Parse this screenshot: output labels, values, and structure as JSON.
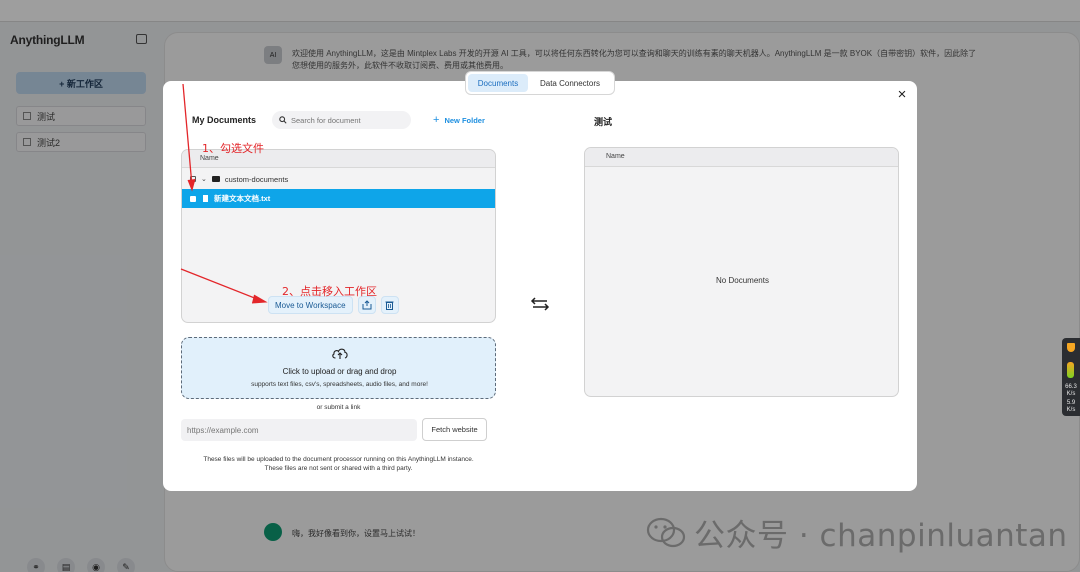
{
  "app": {
    "logo": "AnythingLLM",
    "new_workspace_label": "+ 新工作区",
    "workspaces": [
      "测试",
      "测试2"
    ],
    "footer_icons": [
      "link-icon",
      "book-icon",
      "discord-icon",
      "wrench-icon"
    ]
  },
  "chat": {
    "bot_avatar_label": "AI",
    "intro_line1": "欢迎使用 AnythingLLM，这是由 Mintplex Labs 开发的开源 AI 工具，可以将任何东西转化为您可以查询和聊天的训练有素的聊天机器人。AnythingLLM 是一款 BYOK（自带密钥）软件，因此除了",
    "intro_line2": "您想使用的服务外，此软件不收取订阅费、费用或其他费用。",
    "user_msg": "嗨，我好像看到你，设置马上试试！"
  },
  "modal": {
    "tabs": [
      {
        "label": "Documents",
        "active": true
      },
      {
        "label": "Data Connectors",
        "active": false
      }
    ],
    "close": "×",
    "my_docs": {
      "title": "My Documents",
      "search_placeholder": "Search for document",
      "new_folder": "New Folder",
      "column": "Name",
      "folder": "custom-documents",
      "file": "新建文本文档.txt",
      "move_button": "Move to Workspace"
    },
    "upload": {
      "title": "Click to upload or drag and drop",
      "subtitle": "supports text files, csv's, spreadsheets, audio files, and more!",
      "or_link": "or submit a link",
      "url_placeholder": "https://example.com",
      "fetch_button": "Fetch website",
      "disclaimer_line1": "These files will be uploaded to the document processor running on this AnythingLLM instance.",
      "disclaimer_line2": "These files are not sent or shared with a third party."
    },
    "workspace": {
      "title": "测试",
      "column": "Name",
      "empty": "No Documents"
    }
  },
  "annotations": {
    "step1": "1、勾选文件",
    "step2": "2、点击移入工作区"
  },
  "monitor": {
    "value1": "66.3",
    "unit1": "K/s",
    "value2": "5.9",
    "unit2": "K/s"
  },
  "watermark": "公众号 · chanpinluantan",
  "colors": {
    "accent": "#0ea5e9",
    "annotation": "#e3262a",
    "upload_bg": "#e1f0fb"
  }
}
